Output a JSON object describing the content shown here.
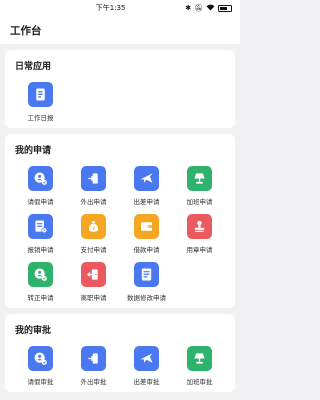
{
  "status_bar": {
    "time": "下午1:35"
  },
  "header": {
    "title": "工作台"
  },
  "sections": {
    "daily": {
      "title": "日常应用",
      "items": [
        {
          "label": "工作日报",
          "icon": "report-icon",
          "color": "#4a78f0"
        }
      ]
    },
    "my_requests": {
      "title": "我的申请",
      "items": [
        {
          "label": "请假申请",
          "icon": "leave-icon",
          "color": "#4a78f0"
        },
        {
          "label": "外出申请",
          "icon": "go-out-icon",
          "color": "#4a78f0"
        },
        {
          "label": "出差申请",
          "icon": "airplane-icon",
          "color": "#4a78f0"
        },
        {
          "label": "加班申请",
          "icon": "lamp-icon",
          "color": "#2fb36c"
        },
        {
          "label": "报销申请",
          "icon": "reimburse-icon",
          "color": "#4a78f0"
        },
        {
          "label": "支付申请",
          "icon": "money-bag-icon",
          "color": "#f5a623"
        },
        {
          "label": "借款申请",
          "icon": "wallet-icon",
          "color": "#f5a623"
        },
        {
          "label": "用章申请",
          "icon": "stamp-icon",
          "color": "#ea5a5f"
        },
        {
          "label": "转正申请",
          "icon": "regularize-icon",
          "color": "#2fb36c"
        },
        {
          "label": "离职申请",
          "icon": "resign-icon",
          "color": "#ea5a5f"
        },
        {
          "label": "数据修改申请",
          "icon": "document-edit-icon",
          "color": "#4a78f0"
        }
      ]
    },
    "my_approvals": {
      "title": "我的审批",
      "items": [
        {
          "label": "请假审批",
          "icon": "leave-icon",
          "color": "#4a78f0"
        },
        {
          "label": "外出审批",
          "icon": "go-out-icon",
          "color": "#4a78f0"
        },
        {
          "label": "出差审批",
          "icon": "airplane-icon",
          "color": "#4a78f0"
        },
        {
          "label": "加班审批",
          "icon": "lamp-icon",
          "color": "#2fb36c"
        }
      ]
    }
  }
}
